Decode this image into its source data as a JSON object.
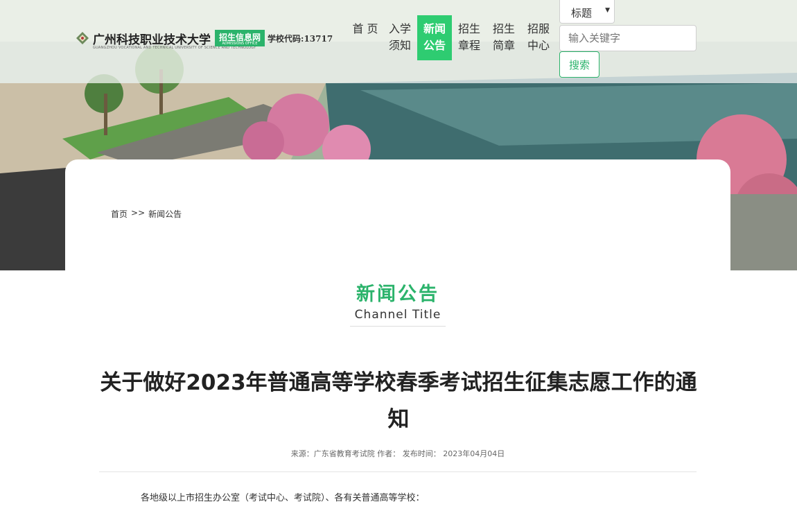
{
  "header": {
    "school_name": "广州科技职业技术大学",
    "school_name_en": "GUANGZHOU VOCATIONAL AND TECHNICAL UNIVERSITY OF SCIENCE AND TECHNOLOGY",
    "badge_label": "招生信息网",
    "badge_sub": "ADMISSIONS OFFICE",
    "school_code": "学校代码:13717"
  },
  "nav": [
    {
      "line1": "首 页",
      "line2": ""
    },
    {
      "line1": "入学",
      "line2": "须知"
    },
    {
      "line1": "新闻",
      "line2": "公告"
    },
    {
      "line1": "招生",
      "line2": "章程"
    },
    {
      "line1": "招生",
      "line2": "简章"
    },
    {
      "line1": "招服",
      "line2": "中心"
    }
  ],
  "search": {
    "select_value": "标题",
    "placeholder": "输入关键字",
    "button_label": "搜索"
  },
  "breadcrumb": {
    "home": "首页",
    "sep": ">>",
    "current": "新闻公告"
  },
  "channel": {
    "title_cn": "新闻公告",
    "title_en": "Channel Title"
  },
  "article": {
    "title": "关于做好2023年普通高等学校春季考试招生征集志愿工作的通知",
    "meta": "来源：广东省教育考试院 作者： 发布时间： 2023年04月04日",
    "first_line": "各地级以上市招生办公室（考试中心、考试院）、各有关普通高等学校："
  },
  "colors": {
    "accent": "#2bb36b",
    "nav_active": "#2ecc71"
  }
}
